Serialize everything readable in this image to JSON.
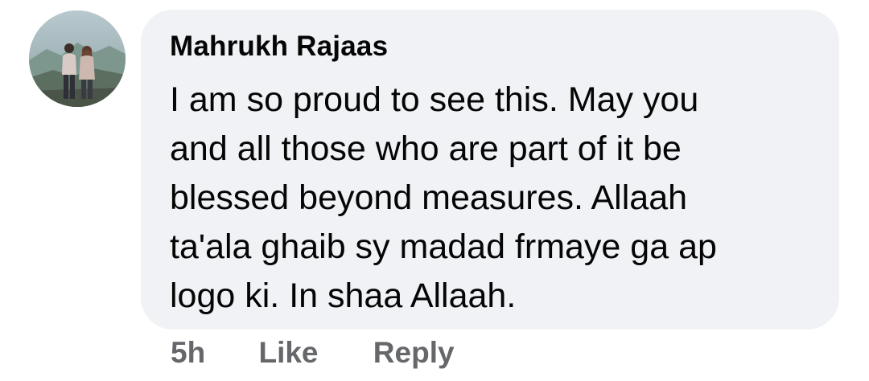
{
  "comment": {
    "author": "Mahrukh Rajaas",
    "text_lines": [
      "I am so proud to see this. May you",
      "and all those who are part of it be",
      "blessed beyond measures. Allaah",
      "ta'ala ghaib sy madad frmaye ga ap",
      "logo ki. In shaa Allaah."
    ]
  },
  "actions": {
    "time": "5h",
    "like_label": "Like",
    "reply_label": "Reply"
  },
  "colors": {
    "bubble": "#f0f2f5",
    "text": "#050505",
    "secondary": "#65676b"
  }
}
